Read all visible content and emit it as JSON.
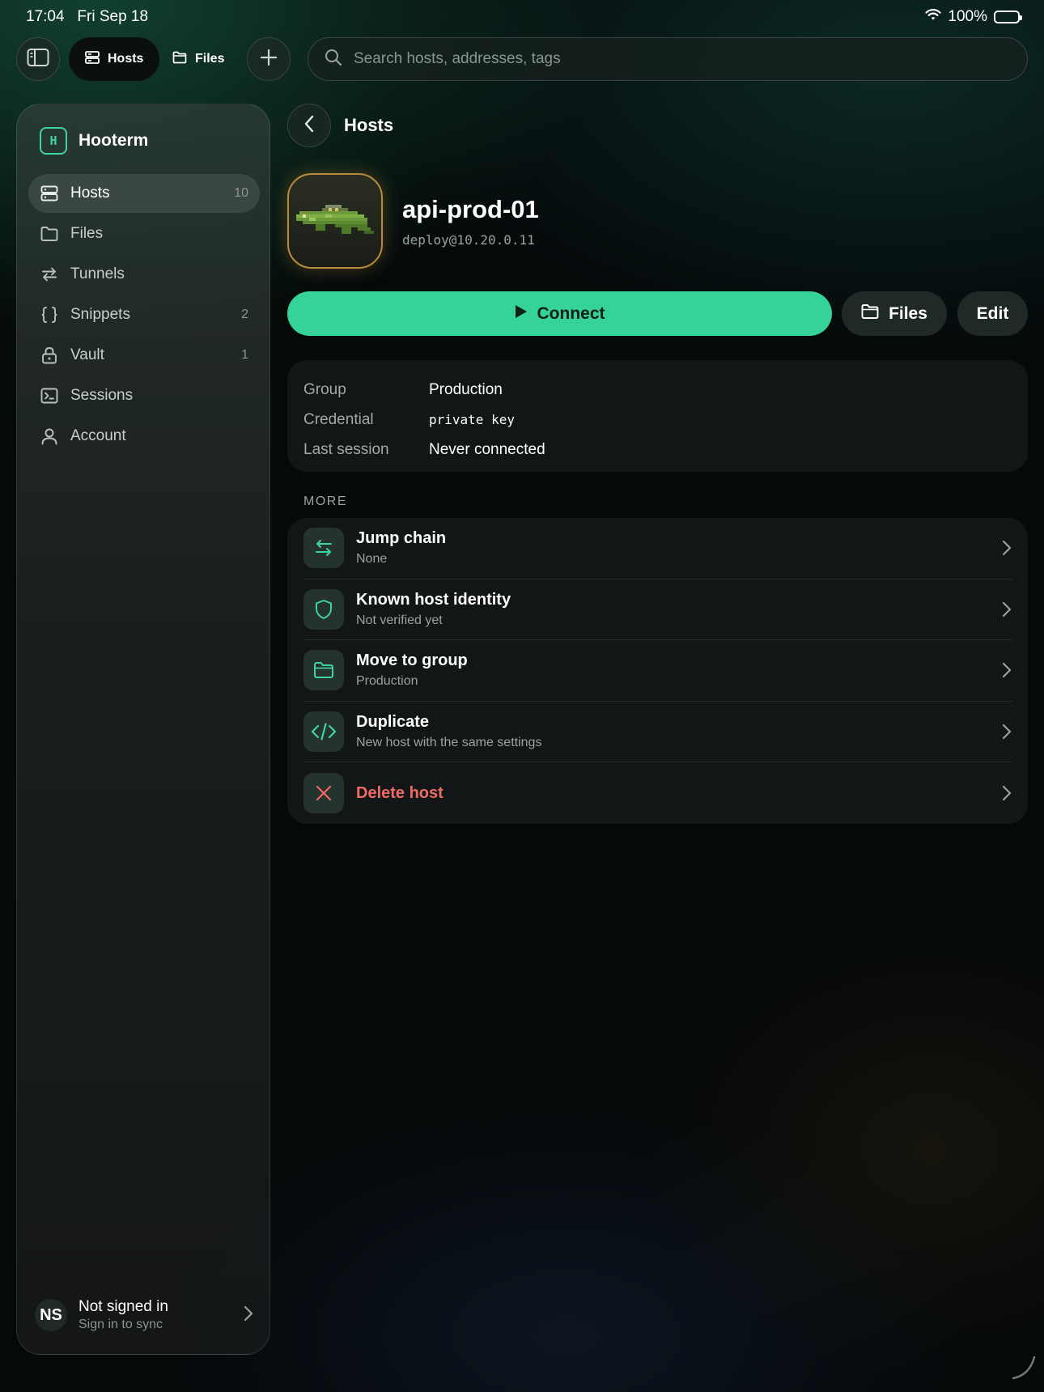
{
  "status_bar": {
    "time": "17:04",
    "date": "Fri Sep 18",
    "battery_label": "100%",
    "battery_level": 1.0
  },
  "topbar": {
    "tabs": [
      {
        "label": "Hosts",
        "icon": "server-icon",
        "active": true
      },
      {
        "label": "Files",
        "icon": "folder-icon",
        "active": false
      }
    ],
    "search_placeholder": "Search hosts, addresses, tags"
  },
  "sidebar": {
    "brand_initial": "H",
    "brand_name": "Hooterm",
    "items": [
      {
        "label": "Hosts",
        "count": "10",
        "icon": "server-icon",
        "active": true
      },
      {
        "label": "Files",
        "count": "",
        "icon": "folder-icon",
        "active": false
      },
      {
        "label": "Tunnels",
        "count": "",
        "icon": "arrows-swap-icon",
        "active": false
      },
      {
        "label": "Snippets",
        "count": "2",
        "icon": "braces-icon",
        "active": false
      },
      {
        "label": "Vault",
        "count": "1",
        "icon": "lock-icon",
        "active": false
      },
      {
        "label": "Sessions",
        "count": "",
        "icon": "terminal-icon",
        "active": false
      },
      {
        "label": "Account",
        "count": "",
        "icon": "person-icon",
        "active": false
      }
    ],
    "account": {
      "initials": "NS",
      "title": "Not signed in",
      "subtitle": "Sign in to sync"
    }
  },
  "main": {
    "back_title": "Hosts",
    "host": {
      "name": "api-prod-01",
      "address": "deploy@10.20.0.11",
      "avatar_icon": "alligator-pixel-icon"
    },
    "actions": {
      "connect": "Connect",
      "files": "Files",
      "edit": "Edit"
    },
    "info": [
      {
        "key": "Group",
        "value": "Production",
        "mono": false
      },
      {
        "key": "Credential",
        "value": "private key",
        "mono": true
      },
      {
        "key": "Last session",
        "value": "Never connected",
        "mono": false
      }
    ],
    "more_label": "MORE",
    "more": [
      {
        "title": "Jump chain",
        "subtitle": "None",
        "icon": "arrows-swap-icon"
      },
      {
        "title": "Known host identity",
        "subtitle": "Not verified yet",
        "icon": "shield-icon"
      },
      {
        "title": "Move to group",
        "subtitle": "Production",
        "icon": "folder-icon"
      },
      {
        "title": "Duplicate",
        "subtitle": "New host with the same settings",
        "icon": "code-icon"
      },
      {
        "title": "Delete host",
        "subtitle": "",
        "icon": "close-icon",
        "danger": true
      }
    ]
  },
  "colors": {
    "accent": "#35d39a",
    "danger": "#ef6b64",
    "avatar_border": "#b88a3c"
  }
}
